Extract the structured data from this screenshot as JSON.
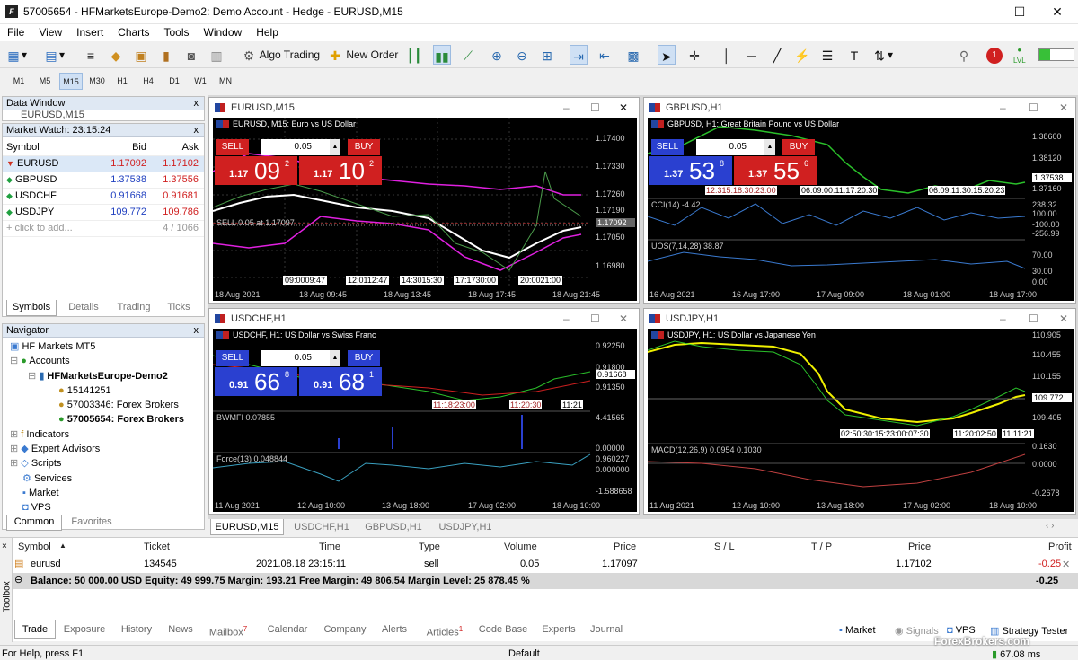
{
  "window": {
    "title": "57005654 - HFMarketsEurope-Demo2: Demo Account - Hedge - EURUSD,M15",
    "minimize": "–",
    "maximize": "☐",
    "close": "✕"
  },
  "menu": [
    "File",
    "View",
    "Insert",
    "Charts",
    "Tools",
    "Window",
    "Help"
  ],
  "toolbar": {
    "algo_trading": "Algo Trading",
    "new_order": "New Order",
    "alert_count": "1",
    "lvl": "LVL"
  },
  "timeframes": [
    "M1",
    "M5",
    "M15",
    "M30",
    "H1",
    "H4",
    "D1",
    "W1",
    "MN"
  ],
  "data_window": {
    "title": "Data Window",
    "content": "EURUSD,M15",
    "close": "x"
  },
  "market_watch": {
    "title": "Market Watch: 23:15:24",
    "close": "x",
    "headers": [
      "Symbol",
      "Bid",
      "Ask"
    ],
    "rows": [
      {
        "symbol": "EURUSD",
        "bid": "1.17092",
        "ask": "1.17102",
        "dir": "down"
      },
      {
        "symbol": "GBPUSD",
        "bid": "1.37538",
        "ask": "1.37556",
        "dir": "up"
      },
      {
        "symbol": "USDCHF",
        "bid": "0.91668",
        "ask": "0.91681",
        "dir": "up"
      },
      {
        "symbol": "USDJPY",
        "bid": "109.772",
        "ask": "109.786",
        "dir": "up"
      }
    ],
    "add": "click to add...",
    "count": "4 / 1066",
    "tabs": [
      "Symbols",
      "Details",
      "Trading",
      "Ticks"
    ]
  },
  "navigator": {
    "title": "Navigator",
    "close": "x",
    "items": [
      {
        "label": "HF Markets MT5",
        "level": 0,
        "bold": false
      },
      {
        "label": "Accounts",
        "level": 1,
        "bold": false
      },
      {
        "label": "HFMarketsEurope-Demo2",
        "level": 2,
        "bold": true
      },
      {
        "label": "15141251",
        "level": 3,
        "bold": false
      },
      {
        "label": "57003346: Forex Brokers",
        "level": 3,
        "bold": false
      },
      {
        "label": "57005654: Forex Brokers",
        "level": 3,
        "bold": true
      },
      {
        "label": "Indicators",
        "level": 1,
        "bold": false
      },
      {
        "label": "Expert Advisors",
        "level": 1,
        "bold": false
      },
      {
        "label": "Scripts",
        "level": 1,
        "bold": false
      },
      {
        "label": "Services",
        "level": 1,
        "bold": false
      },
      {
        "label": "Market",
        "level": 1,
        "bold": false
      },
      {
        "label": "VPS",
        "level": 1,
        "bold": false
      }
    ],
    "tabs": [
      "Common",
      "Favorites"
    ]
  },
  "charts": [
    {
      "id": "eurusd",
      "title": "EURUSD,M15",
      "symbol_line": "EURUSD, M15:  Euro vs US Dollar",
      "sell": "SELL",
      "buy": "BUY",
      "volume": "0.05",
      "sell_small": "1.17",
      "sell_big": "09",
      "sell_sup": "2",
      "buy_small": "1.17",
      "buy_big": "10",
      "buy_sup": "2",
      "prices": [
        "1.17400",
        "1.17330",
        "1.17260",
        "1.17190",
        "1.17120",
        "1.17050",
        "1.16980"
      ],
      "current": "1.17092",
      "order_line": "SELL 0.05 at 1.17097",
      "times": [
        "18 Aug 2021",
        "18 Aug 09:45",
        "18 Aug 13:45",
        "18 Aug 17:45",
        "18 Aug 21:45"
      ],
      "sessions": [
        "09:0009:47",
        "12:0112:47",
        "14:3015:30",
        "17:1730:00",
        "20:0021:00"
      ]
    },
    {
      "id": "gbpusd",
      "title": "GBPUSD,H1",
      "symbol_line": "GBPUSD, H1:  Great Britain Pound vs US Dollar",
      "sell": "SELL",
      "buy": "BUY",
      "volume": "0.05",
      "sell_small": "1.37",
      "sell_big": "53",
      "sell_sup": "8",
      "buy_small": "1.37",
      "buy_big": "55",
      "buy_sup": "6",
      "prices": [
        "1.38600",
        "1.38120",
        "1.37538",
        "1.37160"
      ],
      "current": "1.37538",
      "cci": "CCI(14) -4.42",
      "cci_levels": [
        "238.32",
        "100.00",
        "-100.00",
        "-256.99"
      ],
      "uos": "UOS(7,14,28) 38.87",
      "uos_levels": [
        "70.00",
        "30.00",
        "0.00"
      ],
      "times": [
        "16 Aug 2021",
        "16 Aug 17:00",
        "17 Aug 09:00",
        "18 Aug 01:00",
        "18 Aug 17:00"
      ],
      "sessions": [
        "12:315:18:30:23:00",
        "06:09:00:11:17:20:30",
        "06:09:11:30:15:20:23"
      ]
    },
    {
      "id": "usdchf",
      "title": "USDCHF,H1",
      "symbol_line": "USDCHF, H1:  US Dollar vs Swiss Franc",
      "sell": "SELL",
      "buy": "BUY",
      "volume": "0.05",
      "sell_small": "0.91",
      "sell_big": "66",
      "sell_sup": "8",
      "buy_small": "0.91",
      "buy_big": "68",
      "buy_sup": "1",
      "prices": [
        "0.92250",
        "0.91800",
        "0.91668",
        "0.91350"
      ],
      "current": "0.91668",
      "bwmfi": "BWMFI 0.07855",
      "bwmfi_levels": [
        "4.41565",
        "0.00000"
      ],
      "force": "Force(13) 0.048844",
      "force_levels": [
        "0.960227",
        "0.000000",
        "-1.588658"
      ],
      "times": [
        "11 Aug 2021",
        "12 Aug 10:00",
        "13 Aug 18:00",
        "17 Aug 02:00",
        "18 Aug 10:00"
      ],
      "sessions": [
        "11:18:23:00",
        "11:20:30",
        "11:21"
      ]
    },
    {
      "id": "usdjpy",
      "title": "USDJPY,H1",
      "symbol_line": "USDJPY, H1:  US Dollar vs Japanese Yen",
      "prices": [
        "110.905",
        "110.455",
        "110.155",
        "109.772",
        "109.405"
      ],
      "current": "109.772",
      "macd": "MACD(12,26,9) 0.0954 0.1030",
      "macd_levels": [
        "0.1630",
        "0.0000",
        "-0.2678"
      ],
      "times": [
        "11 Aug 2021",
        "12 Aug 10:00",
        "13 Aug 18:00",
        "17 Aug 02:00",
        "18 Aug 10:00"
      ],
      "sessions": [
        "02:50:30:15:23:00:07:30",
        "11:20:02:50",
        "11:11:21"
      ]
    }
  ],
  "chart_tabs": [
    "EURUSD,M15",
    "USDCHF,H1",
    "GBPUSD,H1",
    "USDJPY,H1"
  ],
  "trade": {
    "headers": [
      "Symbol",
      "Ticket",
      "Time",
      "Type",
      "Volume",
      "Price",
      "S / L",
      "T / P",
      "Price",
      "Profit"
    ],
    "row": {
      "symbol": "eurusd",
      "ticket": "134545",
      "time": "2021.08.18 23:15:11",
      "type": "sell",
      "volume": "0.05",
      "price": "1.17097",
      "sl": "",
      "tp": "",
      "cur": "1.17102",
      "profit": "-0.25"
    },
    "balance": "Balance: 50 000.00 USD  Equity: 49 999.75  Margin: 193.21  Free Margin: 49 806.54  Margin Level: 25 878.45 %",
    "total": "-0.25"
  },
  "toolbox_label": "Toolbox",
  "bottom_tabs": [
    "Trade",
    "Exposure",
    "History",
    "News",
    "Mailbox",
    "Calendar",
    "Company",
    "Alerts",
    "Articles",
    "Code Base",
    "Experts",
    "Journal"
  ],
  "mailbox_count": "7",
  "articles_count": "1",
  "bottom_right": {
    "market": "Market",
    "signals": "Signals",
    "vps": "VPS",
    "tester": "Strategy Tester"
  },
  "status": {
    "help": "For Help, press F1",
    "profile": "Default",
    "ping": "67.08 ms",
    "watermark": "ForexBrokers.com"
  }
}
